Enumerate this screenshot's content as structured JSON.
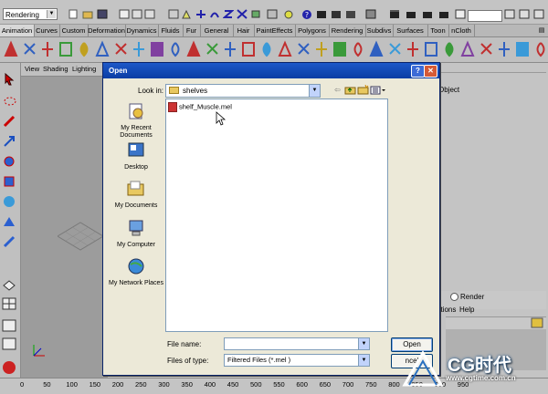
{
  "status_line": {
    "mode": "Rendering"
  },
  "shelf_tabs": [
    "Animation",
    "Curves",
    "Custom",
    "Deformation",
    "Dynamics",
    "Fluids",
    "Fur",
    "General",
    "Hair",
    "PaintEffects",
    "Polygons",
    "Rendering",
    "Subdivs",
    "Surfaces",
    "Toon",
    "nCloth"
  ],
  "panel_menu": [
    "View",
    "Shading",
    "Lighting"
  ],
  "channel_box": {
    "object_label": "Object",
    "render_label": "Render",
    "menu_options": "ptions",
    "menu_help": "Help"
  },
  "time_slider": {
    "ticks": [
      "0",
      "50",
      "100",
      "150",
      "200",
      "250",
      "300",
      "350",
      "400",
      "450",
      "500",
      "550",
      "600",
      "650",
      "700",
      "750",
      "800",
      "850",
      "900",
      "950"
    ]
  },
  "dialog": {
    "title": "Open",
    "look_in_label": "Look in:",
    "look_in_value": "shelves",
    "places": [
      {
        "label": "My Recent Documents",
        "icon": "recent-documents-icon"
      },
      {
        "label": "Desktop",
        "icon": "desktop-icon"
      },
      {
        "label": "My Documents",
        "icon": "my-documents-icon"
      },
      {
        "label": "My Computer",
        "icon": "my-computer-icon"
      },
      {
        "label": "My Network Places",
        "icon": "network-places-icon"
      }
    ],
    "files": [
      "shelf_Muscle.mel"
    ],
    "file_name_label": "File name:",
    "file_name_value": "",
    "files_of_type_label": "Files of type:",
    "files_of_type_value": "Filtered Files (*.mel )",
    "open_label": "Open",
    "cancel_label": "ncel"
  },
  "watermark": {
    "text": "CG时代",
    "url": "www.cgtime.com.cn"
  },
  "colors": {
    "title_bar": "#0a3da4",
    "dialog_bg": "#ece9d8",
    "maya_gray": "#c4c4c4"
  }
}
